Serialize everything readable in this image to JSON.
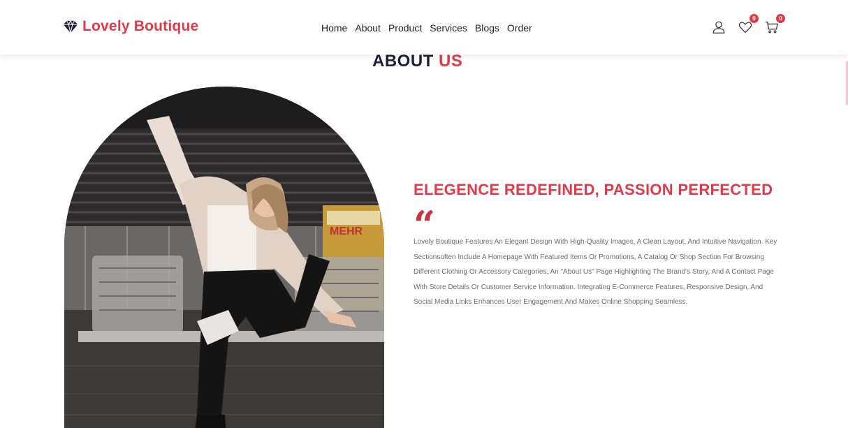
{
  "header": {
    "brand_name": "Lovely Boutique",
    "brand_icon": "diamond-icon",
    "nav": [
      "Home",
      "About",
      "Product",
      "Services",
      "Blogs",
      "Order"
    ],
    "wishlist_count": "0",
    "cart_count": "0",
    "icons": [
      "user-icon",
      "heart-icon",
      "cart-icon"
    ]
  },
  "about": {
    "heading_dark": "ABOUT",
    "heading_accent": "US",
    "headline": "ELEGENCE REDEFINED, PASSION PERFECTED",
    "quote_mark": "“",
    "description": "Lovely Boutique Features An Elegant Design With High-Quality Images, A Clean Layout, And Intuitive Navigation. Key Sectionsoften Include A Homepage With Featured Items Or Promotions, A Catalog Or Shop Section For Browsing Different Clothing Or Accessory Categories, An \"About Us\" Page Highlighting The Brand's Story, And A Contact Page With Store Details Or Customer Service Information. Integrating E-Commerce Features, Responsive Design, And Social Media Links Enhances User Engagement And Makes Online Shopping Seamless.",
    "photo_sign_text": "MEHR"
  },
  "colors": {
    "accent": "#e23a48",
    "dark_heading": "#1f1f3a",
    "body_text": "#6d6d6d"
  }
}
